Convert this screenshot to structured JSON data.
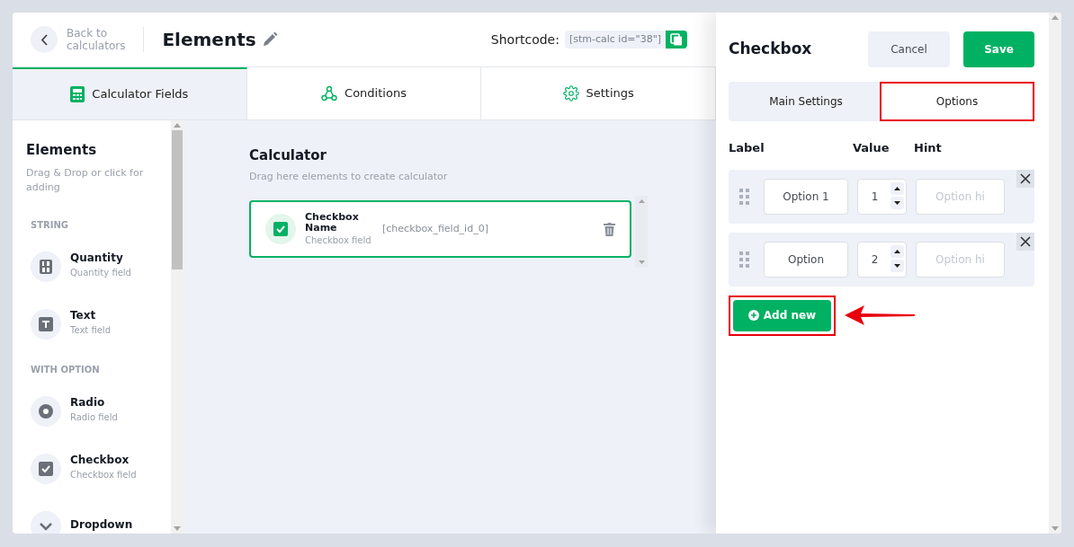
{
  "header": {
    "back": [
      "Back to",
      "calculators"
    ],
    "title": "Elements",
    "shortcode_label": "Shortcode:",
    "shortcode": "[stm-calc id=\"38\"]"
  },
  "tabs": [
    {
      "label": "Calculator Fields",
      "selected": true,
      "kind": "calculator"
    },
    {
      "label": "Conditions",
      "selected": false,
      "kind": "conditions"
    },
    {
      "label": "Settings",
      "selected": false,
      "kind": "settings"
    }
  ],
  "sidebar": {
    "title": "Elements",
    "subtitle": "Drag & Drop or click for adding",
    "sections": [
      {
        "title": "STRING",
        "items": [
          {
            "kind": "quantity",
            "name": "Quantity",
            "desc": "Quantity field"
          },
          {
            "kind": "text",
            "name": "Text",
            "desc": "Text field"
          }
        ]
      },
      {
        "title": "WITH OPTION",
        "items": [
          {
            "kind": "radio",
            "name": "Radio",
            "desc": "Radio field"
          },
          {
            "kind": "checkbox",
            "name": "Checkbox",
            "desc": "Checkbox field"
          },
          {
            "kind": "dropdown",
            "name": "Dropdown"
          }
        ]
      }
    ]
  },
  "canvas": {
    "title": "Calculator",
    "subtitle": "Drag here elements to create calculator",
    "fields": [
      {
        "name": "Checkbox Name",
        "type": "Checkbox field",
        "id": "[checkbox_field_id_0]"
      }
    ]
  },
  "panel": {
    "title": "Checkbox",
    "cancel": "Cancel",
    "save": "Save",
    "tabs": [
      {
        "label": "Main Settings",
        "selected": false,
        "highlighted": false
      },
      {
        "label": "Options",
        "selected": true,
        "highlighted": true
      }
    ],
    "columns": [
      "Label",
      "Value",
      "Hint"
    ],
    "options": [
      {
        "label": "Option 1",
        "value": "1",
        "hint_placeholder": "Option hi"
      },
      {
        "label": "Option",
        "value": "2",
        "hint_placeholder": "Option hi"
      }
    ],
    "add_button": "Add new",
    "add_highlighted": true
  }
}
